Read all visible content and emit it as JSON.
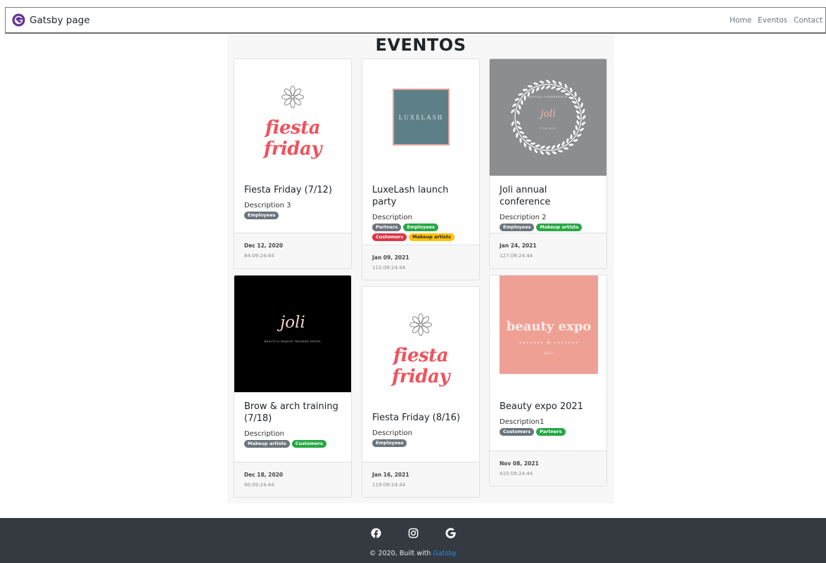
{
  "navbar": {
    "brand": "Gatsby page",
    "links": [
      "Home",
      "Eventos",
      "Contact"
    ]
  },
  "page": {
    "title": "EVENTOS"
  },
  "events": [
    {
      "title": "Fiesta Friday (7/12)",
      "description": "Description 3",
      "tags": [
        "Employees"
      ],
      "date": "Dec 12, 2020",
      "countdown": "84:09:24:44",
      "image_text": "fiesta friday"
    },
    {
      "title": "LuxeLash launch party",
      "description": "Description",
      "tags": [
        "Partners",
        "Employees",
        "Customers",
        "Makeup artists"
      ],
      "date": "Jan 09, 2021",
      "countdown": "112:09:24:44",
      "image_text": "LUXELASH"
    },
    {
      "title": "Joli annual conference",
      "description": "Description 2",
      "tags": [
        "Employees",
        "Makeup artists"
      ],
      "date": "Jan 24, 2021",
      "countdown": "127:09:24:44",
      "image_text": "joli",
      "image_top": "ANNUAL CONFERENCE",
      "image_bottom": "1.24.2021"
    },
    {
      "title": "Brow & arch training (7/18)",
      "description": "Description",
      "tags": [
        "Makeup artists",
        "Customers"
      ],
      "date": "Dec 18, 2020",
      "countdown": "90:09:24:44",
      "image_text": "joli",
      "image_sub": "BEAUTY & MAKEUP TRAINING SERIES"
    },
    {
      "title": "Fiesta Friday (8/16)",
      "description": "Description",
      "tags": [
        "Employees"
      ],
      "date": "Jan 16, 2021",
      "countdown": "119:09:24:44",
      "image_text": "fiesta friday"
    },
    {
      "title": "Beauty expo 2021",
      "description": "Description1",
      "tags": [
        "Customers",
        "Partners"
      ],
      "date": "Nov 08, 2021",
      "countdown": "415:09:24:44",
      "image_text": "beauty expo",
      "image_dots": "••••••• ✣ •••••••",
      "image_year": "2021"
    }
  ],
  "footer": {
    "social_icons": [
      "facebook-icon",
      "instagram-icon",
      "google-icon"
    ],
    "copyright_prefix": "© 2020, Built with",
    "copyright_link": "Gatsby"
  },
  "colors": {
    "secondary": "#6c757d",
    "success": "#28a745",
    "danger": "#dc3545",
    "warning": "#ffc107",
    "footer_bg": "#343a40",
    "link": "#1e90ff",
    "brand_purple": "#663399"
  }
}
